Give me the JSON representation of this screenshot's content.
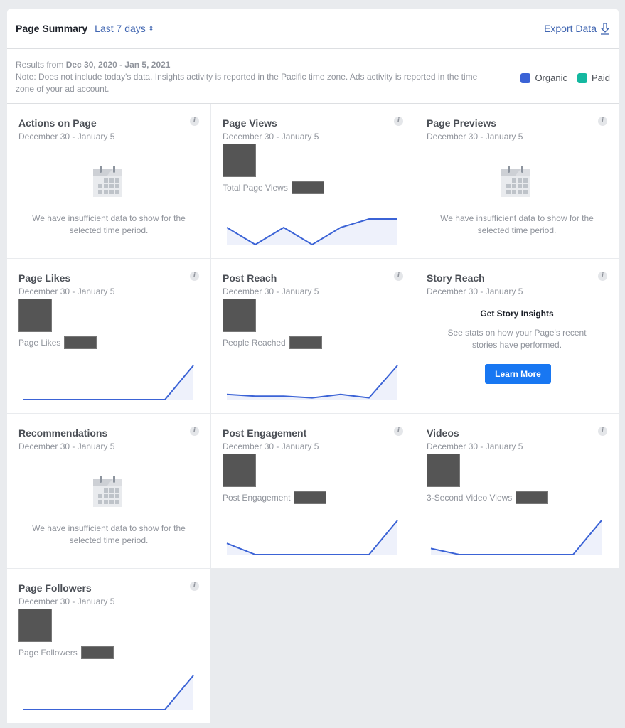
{
  "header": {
    "title": "Page Summary",
    "range_label": "Last 7 days",
    "range_icon": "sort-arrows-icon",
    "export_label": "Export Data",
    "export_icon": "download-icon"
  },
  "info": {
    "results_prefix": "Results from ",
    "results_range": "Dec 30, 2020 - Jan 5, 2021",
    "note": "Note: Does not include today's data. Insights activity is reported in the Pacific time zone. Ads activity is reported in the time zone of your ad account."
  },
  "legend": [
    {
      "label": "Organic",
      "color": "#3b63d6"
    },
    {
      "label": "Paid",
      "color": "#14b8a0"
    }
  ],
  "colors": {
    "line": "#3b63d6",
    "fill": "#eef1fb",
    "button": "#1877f2"
  },
  "cards": [
    {
      "title": "Actions on Page",
      "date": "December 30 - January 5",
      "type": "nodata",
      "message": "We have insufficient data to show for the selected time period."
    },
    {
      "title": "Page Views",
      "date": "December 30 - January 5",
      "type": "chart",
      "metric_label": "Total Page Views",
      "series": [
        0.5,
        0.0,
        0.5,
        0.0,
        0.5,
        0.75,
        0.75
      ]
    },
    {
      "title": "Page Previews",
      "date": "December 30 - January 5",
      "type": "nodata",
      "message": "We have insufficient data to show for the selected time period."
    },
    {
      "title": "Page Likes",
      "date": "December 30 - January 5",
      "type": "chart",
      "metric_label": "Page Likes",
      "series": [
        0,
        0,
        0,
        0,
        0,
        0,
        1
      ]
    },
    {
      "title": "Post Reach",
      "date": "December 30 - January 5",
      "type": "chart",
      "metric_label": "People Reached",
      "series": [
        0.15,
        0.1,
        0.1,
        0.05,
        0.15,
        0.05,
        1
      ]
    },
    {
      "title": "Story Reach",
      "date": "December 30 - January 5",
      "type": "story",
      "heading": "Get Story Insights",
      "description": "See stats on how your Page's recent stories have performed.",
      "button": "Learn More"
    },
    {
      "title": "Recommendations",
      "date": "December 30 - January 5",
      "type": "nodata",
      "message": "We have insufficient data to show for the selected time period."
    },
    {
      "title": "Post Engagement",
      "date": "December 30 - January 5",
      "type": "chart",
      "metric_label": "Post Engagement",
      "series": [
        0.33,
        0,
        0,
        0,
        0,
        0,
        1
      ]
    },
    {
      "title": "Videos",
      "date": "December 30 - January 5",
      "type": "chart",
      "metric_label": "3-Second Video Views",
      "series": [
        0.18,
        0,
        0,
        0,
        0,
        0,
        1
      ]
    },
    {
      "title": "Page Followers",
      "date": "December 30 - January 5",
      "type": "chart",
      "metric_label": "Page Followers",
      "series": [
        0,
        0,
        0,
        0,
        0,
        0,
        1
      ]
    }
  ]
}
